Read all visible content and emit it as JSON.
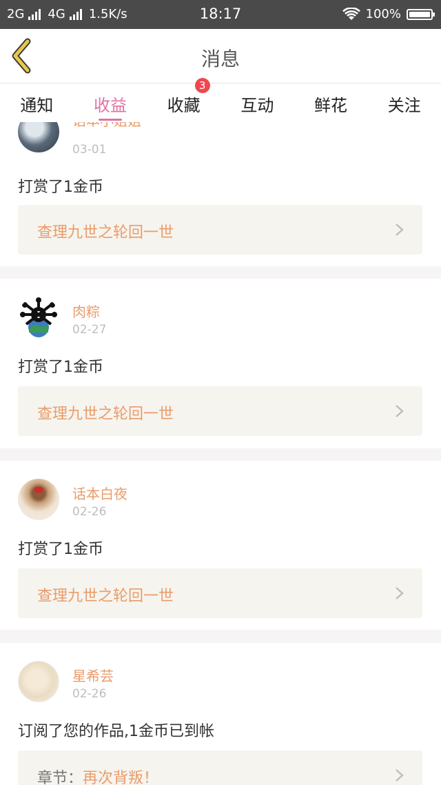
{
  "status_bar": {
    "network1": "2G",
    "network2": "4G",
    "speed": "1.5K/s",
    "time": "18:17",
    "battery": "100%"
  },
  "header": {
    "title": "消息",
    "back_icon": "back-chevron-icon",
    "accent_color": "#e8c84a"
  },
  "tabs": [
    {
      "label": "通知"
    },
    {
      "label": "收益",
      "active": true
    },
    {
      "label": "收藏",
      "badge": "3"
    },
    {
      "label": "互动"
    },
    {
      "label": "鲜花"
    },
    {
      "label": "关注"
    }
  ],
  "items": [
    {
      "name": "话本小姐姐",
      "date": "03-01",
      "action": "打赏了1金币",
      "work": "查理九世之轮回一世"
    },
    {
      "name": "肉粽",
      "date": "02-27",
      "action": "打赏了1金币",
      "work": "查理九世之轮回一世"
    },
    {
      "name": "话本白夜",
      "date": "02-26",
      "action": "打赏了1金币",
      "work": "查理九世之轮回一世"
    },
    {
      "name": "星希芸",
      "date": "02-26",
      "action": "订阅了您的作品,1金币已到帐",
      "work_label": "章节：",
      "work": "再次背叛！"
    }
  ],
  "colors": {
    "active_tab": "#e072a6",
    "name": "#e99c6b",
    "badge": "#f0474f"
  }
}
